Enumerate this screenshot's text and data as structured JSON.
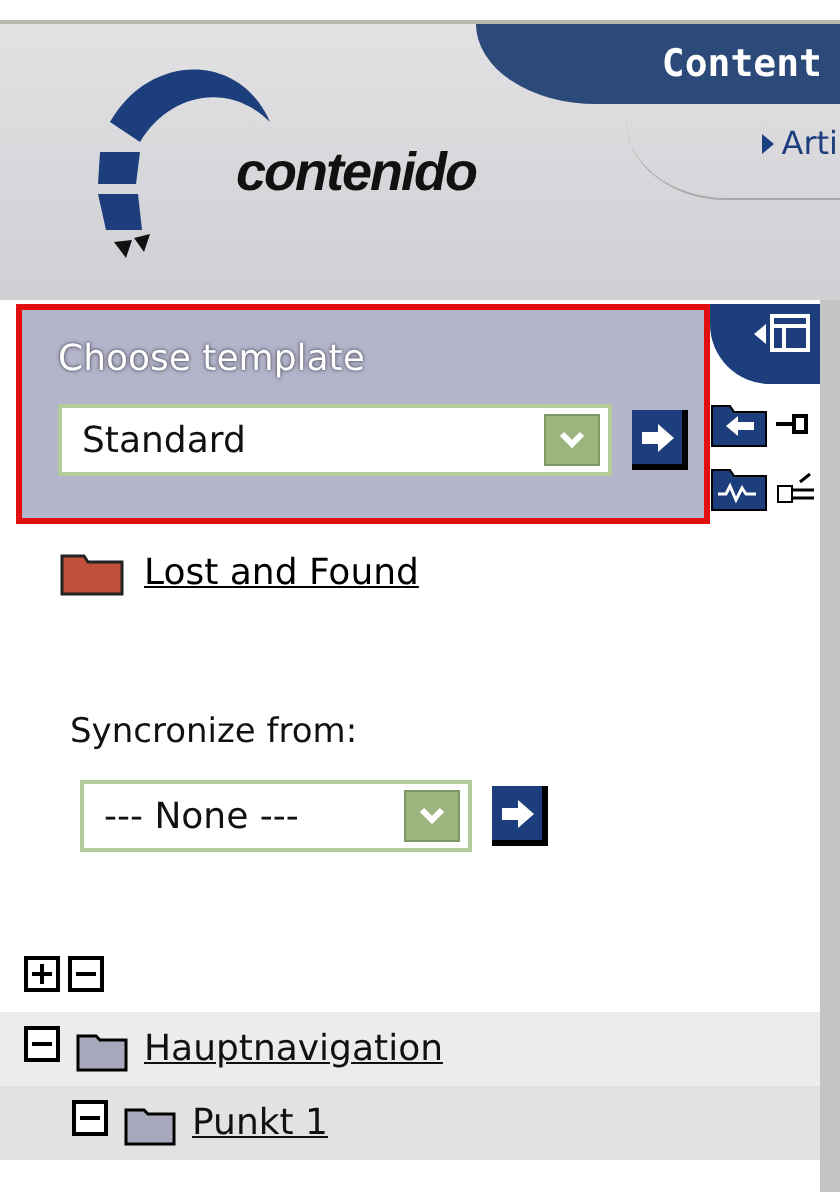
{
  "header": {
    "logo_text": "contenido",
    "tab": "Content",
    "subnav": "Arti"
  },
  "template": {
    "label": "Choose template",
    "value": "Standard"
  },
  "folder": {
    "label": "Lost and Found"
  },
  "sync": {
    "label": "Syncronize from:",
    "value": "--- None ---"
  },
  "tree": [
    {
      "label": "Hauptnavigation",
      "expanded": true,
      "children": [
        {
          "label": "Punkt 1",
          "expanded": true
        }
      ]
    }
  ]
}
